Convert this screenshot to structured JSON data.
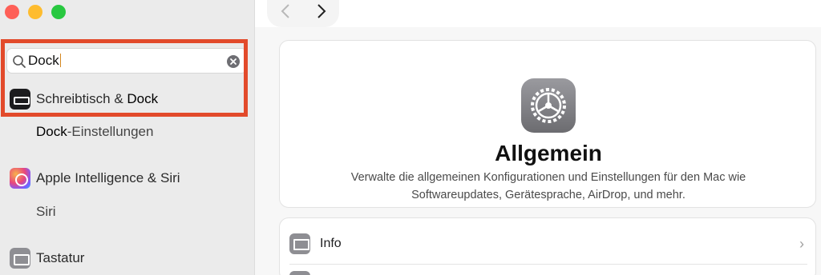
{
  "window": {
    "traffic_lights": [
      "close",
      "minimize",
      "zoom"
    ],
    "colors": {
      "close": "#fe5f57",
      "minimize": "#febc2e",
      "zoom": "#28c840",
      "highlight": "#e24a2b"
    }
  },
  "toolbar": {
    "back_icon": "chevron-left-icon",
    "forward_icon": "chevron-right-icon"
  },
  "sidebar": {
    "search": {
      "query": "Dock"
    },
    "items": [
      {
        "prefix": "Schreibtisch & ",
        "match": "Dock",
        "icon": "dock-icon"
      },
      {
        "match": "Dock",
        "suffix": "-Einstellungen"
      },
      {
        "label": "Apple Intelligence & Siri",
        "icon": "apple-intelligence-icon"
      },
      {
        "label": "Siri"
      },
      {
        "label": "Tastatur",
        "icon": "keyboard-icon"
      }
    ]
  },
  "main": {
    "header": {
      "icon": "gear-icon",
      "title": "Allgemein",
      "description": "Verwalte die allgemeinen Konfigurationen und Einstellungen für den Mac wie Softwareupdates, Gerätesprache, AirDrop, und mehr."
    },
    "rows": [
      {
        "label": "Info",
        "icon": "laptop-icon"
      }
    ]
  }
}
